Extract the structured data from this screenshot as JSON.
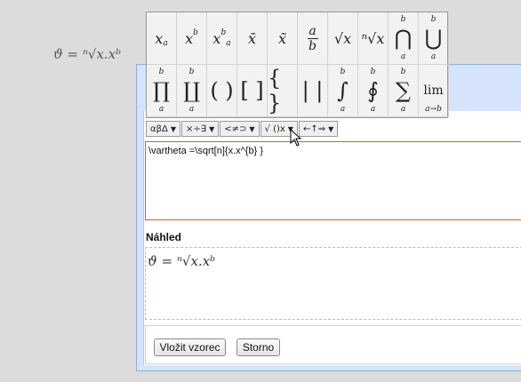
{
  "document": {
    "formula_display": "ϑ = ⁿ√x.xᵇ"
  },
  "palette": {
    "row1": [
      {
        "name": "subscript",
        "base": "x",
        "sub": "a"
      },
      {
        "name": "superscript",
        "base": "x",
        "sup": "b"
      },
      {
        "name": "sup-sub",
        "base": "x",
        "sup": "b",
        "sub": "a"
      },
      {
        "name": "bar",
        "base": "x̄"
      },
      {
        "name": "tilde",
        "base": "x̃"
      },
      {
        "name": "fraction",
        "num": "a",
        "den": "b"
      },
      {
        "name": "sqrt",
        "base": "√x"
      },
      {
        "name": "nth-root",
        "base": "ⁿ√x"
      },
      {
        "name": "big-cap",
        "base": "⋂",
        "sup": "b",
        "sub": "a"
      },
      {
        "name": "big-cup",
        "base": "⋃",
        "sup": "b",
        "sub": "a"
      }
    ],
    "row2": [
      {
        "name": "product",
        "base": "∏",
        "sup": "b",
        "sub": "a"
      },
      {
        "name": "coproduct",
        "base": "∐",
        "sup": "b",
        "sub": "a"
      },
      {
        "name": "parentheses",
        "base": "( )"
      },
      {
        "name": "brackets",
        "base": "[ ]"
      },
      {
        "name": "braces",
        "base": "{ }"
      },
      {
        "name": "abs",
        "base": "| |"
      },
      {
        "name": "integral",
        "base": "∫",
        "sup": "b",
        "sub": "a"
      },
      {
        "name": "contour-integral",
        "base": "∮",
        "sup": "b",
        "sub": "a"
      },
      {
        "name": "sum",
        "base": "∑",
        "sup": "b",
        "sub": "a"
      },
      {
        "name": "limit",
        "base": "lim",
        "sub": "a→b"
      }
    ]
  },
  "toolbar": {
    "greek_label": "αβΔ",
    "operators_label": "×÷∃",
    "relations_label": "<≠⊃",
    "structures_label": "√ ()x",
    "arrows_label": "←↑⇒",
    "dropdown_arrow": "▼"
  },
  "editor": {
    "value": "\\vartheta =\\sqrt[n]{x.x^{b} }"
  },
  "preview": {
    "label": "Náhled",
    "formula_display": "ϑ = ⁿ√x.xᵇ"
  },
  "buttons": {
    "insert_label": "Vložit vzorec",
    "cancel_label": "Storno"
  },
  "colors": {
    "editor_border": "#b87312",
    "dialog_bg": "#d6e4fb",
    "dialog_border": "#8aaee6"
  }
}
